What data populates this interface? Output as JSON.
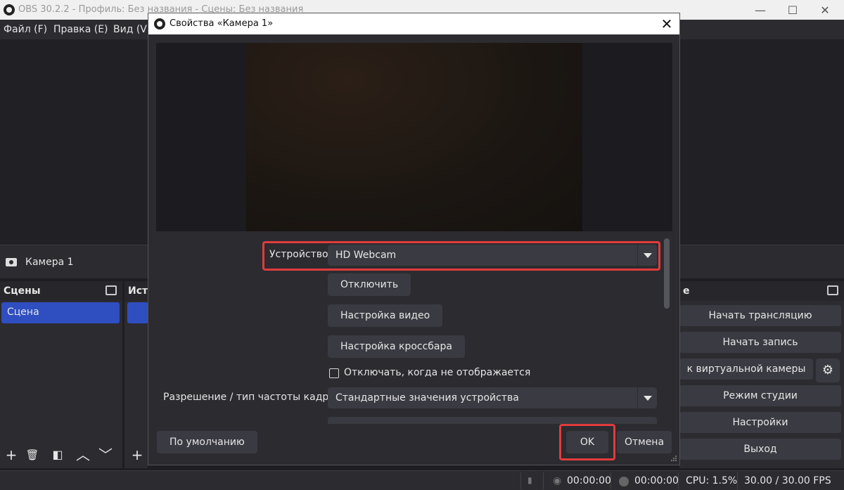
{
  "window": {
    "title": "OBS 30.2.2 - Профиль: Без названия - Сцены: Без названия",
    "minimize": "—",
    "maximize": "☐",
    "close": "✕"
  },
  "menu": [
    "Файл (F)",
    "Правка (E)",
    "Вид (V)"
  ],
  "source_bar": {
    "label": "Камера 1"
  },
  "scenes": {
    "title": "Сцены",
    "items": [
      "Сцена"
    ],
    "tools": [
      "+",
      "🗑",
      "◧",
      "︿",
      "﹀"
    ]
  },
  "sources": {
    "title": "Ист",
    "add": "+"
  },
  "controls": {
    "title": "е",
    "buttons": [
      "Начать трансляцию",
      "Начать запись",
      "к виртуальной камеры",
      "Режим студии",
      "Настройки",
      "Выход"
    ],
    "gear": "⚙"
  },
  "status": {
    "stream_time": "00:00:00",
    "rec_time": "00:00:00",
    "cpu": "CPU: 1.5%",
    "fps": "30.00 / 30.00 FPS"
  },
  "dialog": {
    "title": "Свойства «Камера 1»",
    "close": "✕",
    "device_label": "Устройство",
    "device_value": "HD Webcam",
    "btn_disconnect": "Отключить",
    "btn_video": "Настройка видео",
    "btn_crossbar": "Настройка кроссбара",
    "chk_label": "Отключать, когда не отображается",
    "res_label": "Разрешение / тип частоты кадров",
    "res_value": "Стандартные значения устройства",
    "btn_default": "По умолчанию",
    "btn_ok": "OK",
    "btn_cancel": "Отмена"
  },
  "colors": {
    "highlight": "#e23b3b",
    "selection": "#2f4ec0",
    "panel": "#2b2b30"
  }
}
